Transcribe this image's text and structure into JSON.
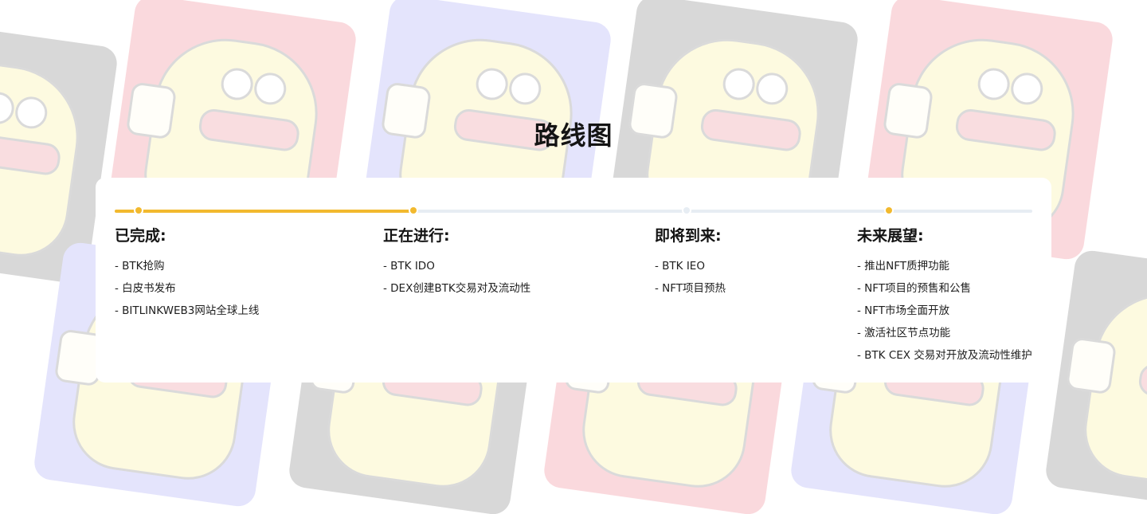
{
  "page": {
    "title": "路线图"
  },
  "colors": {
    "accent": "#f2b92e",
    "track": "#e7edf3",
    "text": "#141414"
  },
  "roadmap": {
    "progress_fraction": 0.325,
    "milestone_dots": [
      "done",
      "done",
      "pending",
      "done"
    ],
    "columns": [
      {
        "title": "已完成:",
        "items": [
          "- BTK抢购",
          "- 白皮书发布",
          "- BITLINKWEB3网站全球上线"
        ]
      },
      {
        "title": "正在进行:",
        "items": [
          "- BTK IDO",
          "- DEX创建BTK交易对及流动性"
        ]
      },
      {
        "title": "即将到来:",
        "items": [
          "- BTK IEO",
          "- NFT项目预热"
        ]
      },
      {
        "title": "未来展望:",
        "items": [
          "- 推出NFT质押功能",
          "- NFT项目的预售和公售",
          "- NFT市场全面开放",
          "- 激活社区节点功能",
          "- BTK CEX 交易对开放及流动性维护"
        ]
      }
    ]
  }
}
